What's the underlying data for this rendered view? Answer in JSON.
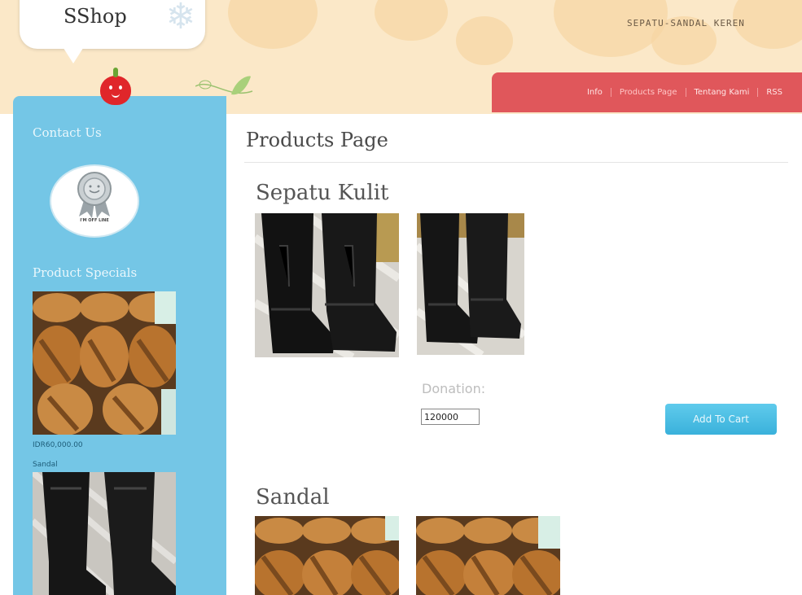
{
  "header": {
    "logo_text": "SShop",
    "tagline": "SEPATU-SANDAL KEREN"
  },
  "nav": {
    "items": [
      {
        "label": "Info"
      },
      {
        "label": "Products Page"
      },
      {
        "label": "Tentang Kami"
      },
      {
        "label": "RSS"
      }
    ]
  },
  "sidebar": {
    "contact_title": "Contact Us",
    "status_badge": "I'M OFF LINE",
    "specials_title": "Product Specials",
    "special_price": "IDR60,000.00",
    "special_name": "Sandal"
  },
  "main": {
    "page_title": "Products Page",
    "products": [
      {
        "name": "Sepatu Kulit",
        "donation_label": "Donation:",
        "donation_value": "120000",
        "cart_label": "Add To Cart"
      },
      {
        "name": "Sandal"
      }
    ]
  },
  "colors": {
    "sidebar": "#74c6e6",
    "nav": "#e0575b",
    "header": "#fbe8c8",
    "cart_button": "#3ab1db"
  }
}
